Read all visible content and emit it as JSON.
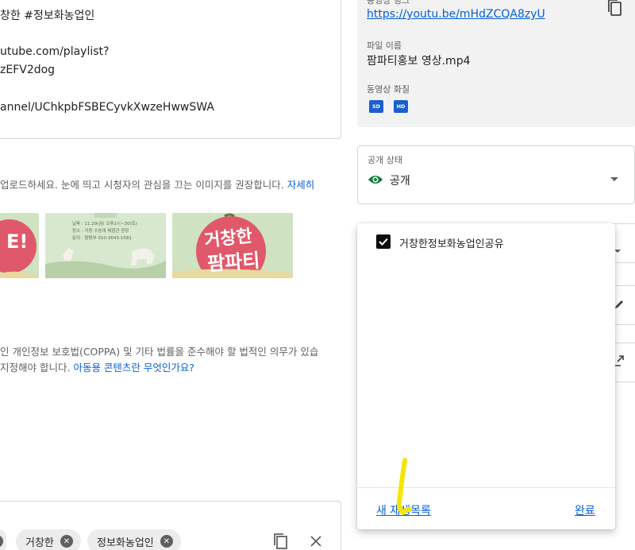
{
  "description": {
    "lines": [
      "창한 #정보화농업인",
      "utube.com/playlist?",
      "zEFV2dog",
      "annel/UChkpbFSBECyvkXwzeHwwSWA"
    ]
  },
  "thumbnail": {
    "hint": "업로드하세요. 눈에 띄고 시청자의 관심을 끄는 이미지를 권장합니다.",
    "more_link": "자세히",
    "thumb1_text": "E!",
    "thumb2_lines": [
      "날짜 : 11.29(금) 오후2시~30(토)",
      "장소 : 거창 수승대 체험관 광장",
      "문의 : 팜팜부 010-3643-1581"
    ],
    "thumb3_top": "거창한",
    "thumb3_bottom": "팜파티"
  },
  "coppa": {
    "line1": "인 개인정보 보호법(COPPA) 및 기타 법률을 준수해야 할 법적인 의무가 있습",
    "line2": "지정해야 합니다.",
    "link": "아동용 콘텐츠란 무엇인가요?"
  },
  "tags": [
    "거창한",
    "정보화농업인"
  ],
  "info_panel": {
    "link_label": "동영상 링크",
    "link": "https://youtu.be/mHdZCQA8zyU",
    "filename_label": "파일 이름",
    "filename": "팜파티홍보 영상.mp4",
    "quality_label": "동영상 화질",
    "quality_badges": [
      "SD",
      "HD"
    ]
  },
  "visibility": {
    "label": "공개 상태",
    "value": "공개"
  },
  "playlist_dropdown": {
    "items": [
      {
        "label": "거창한정보화농업인공유",
        "checked": true
      }
    ],
    "new_playlist": "새 재생목록",
    "done": "완료"
  },
  "colors": {
    "link_blue": "#065fd4",
    "visibility_green": "#0f7a3a",
    "annotation_yellow": "#f5e600"
  },
  "icons": [
    "copy-icon",
    "eye-icon",
    "dropdown-arrow-icon",
    "pencil-icon",
    "external-link-icon",
    "close-icon",
    "checkbox-checked-icon"
  ]
}
